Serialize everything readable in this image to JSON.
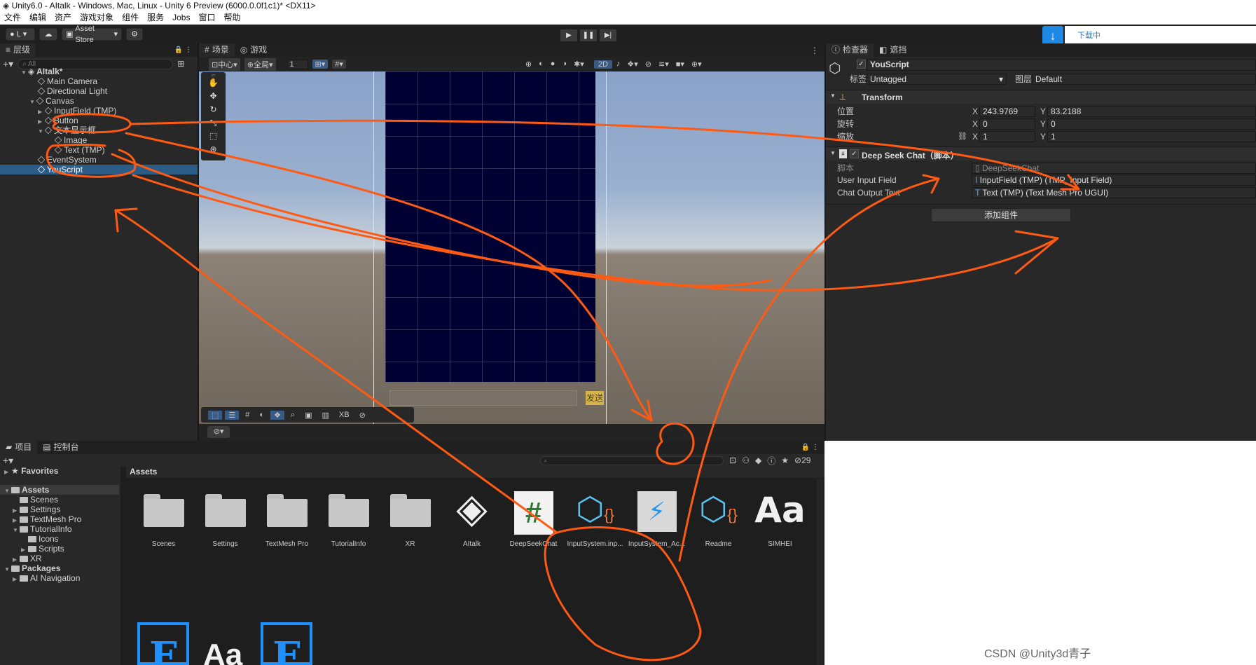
{
  "window": {
    "title": "Unity6.0 - AItalk - Windows, Mac, Linux - Unity 6 Preview (6000.0.0f1c1)* <DX11>"
  },
  "menu": [
    "文件",
    "编辑",
    "资产",
    "游戏对象",
    "组件",
    "服务",
    "Jobs",
    "窗口",
    "帮助"
  ],
  "toolbar": {
    "account": "L",
    "asset_store": "Asset Store",
    "download_label": "下载中"
  },
  "hierarchy": {
    "tab": "层级",
    "search_placeholder": "All",
    "items": [
      {
        "label": "AItalk*"
      },
      {
        "label": "Main Camera"
      },
      {
        "label": "Directional Light"
      },
      {
        "label": "Canvas"
      },
      {
        "label": "InputField (TMP)"
      },
      {
        "label": "Button"
      },
      {
        "label": "文本显示框"
      },
      {
        "label": "Image"
      },
      {
        "label": "Text (TMP)"
      },
      {
        "label": "EventSystem"
      },
      {
        "label": "YouScript"
      }
    ]
  },
  "scene": {
    "tab_scene": "场景",
    "tab_game": "游戏",
    "pivot": "中心",
    "global": "全局",
    "grid_value": "1",
    "mode_2d": "2D",
    "send_button": "发送",
    "overlay_xb": "XB"
  },
  "inspector": {
    "tab": "检查器",
    "tab2": "遮挡",
    "object_name": "YouScript",
    "tag_label": "标签",
    "tag_value": "Untagged",
    "layer_label": "图层",
    "layer_value": "Default",
    "transform": {
      "title": "Transform",
      "position_label": "位置",
      "rotation_label": "旋转",
      "scale_label": "缩放",
      "pos_x": "243.9769",
      "pos_y": "83.2188",
      "rot_x": "0",
      "rot_y": "0",
      "scl_x": "1",
      "scl_y": "1",
      "x": "X",
      "y": "Y"
    },
    "component": {
      "title": "Deep Seek Chat（脚本）",
      "script_label": "脚本",
      "script_value": "DeepSeekChat",
      "input_label": "User Input Field",
      "input_value": "InputField (TMP) (TMP_Input Field)",
      "output_label": "Chat Output Text",
      "output_value": "Text (TMP) (Text Mesh Pro UGUI)"
    },
    "add_component": "添加组件"
  },
  "project": {
    "tab": "项目",
    "tab2": "控制台",
    "hidden_count": "29",
    "favorites": "Favorites",
    "assets_header": "Assets",
    "tree": [
      "Assets",
      "Scenes",
      "Settings",
      "TextMesh Pro",
      "TutorialInfo",
      "Icons",
      "Scripts",
      "XR",
      "Packages",
      "AI Navigation"
    ],
    "grid": [
      {
        "label": "Scenes",
        "icon": "folder-icon"
      },
      {
        "label": "Settings",
        "icon": "folder-icon"
      },
      {
        "label": "TextMesh Pro",
        "icon": "folder-icon"
      },
      {
        "label": "TutorialInfo",
        "icon": "folder-icon"
      },
      {
        "label": "XR",
        "icon": "folder-icon"
      },
      {
        "label": "AItalk",
        "icon": "unity-scene-icon"
      },
      {
        "label": "DeepSeekChat",
        "icon": "csharp-script-icon"
      },
      {
        "label": "InputSystem.inp...",
        "icon": "input-actions-icon"
      },
      {
        "label": "InputSystem_Ac...",
        "icon": "input-map-icon"
      },
      {
        "label": "Readme",
        "icon": "readme-icon"
      },
      {
        "label": "SIMHEI",
        "icon": "font-icon"
      }
    ]
  },
  "watermark": "CSDN @Unity3d青子",
  "colors": {
    "annotation": "#ff5a14",
    "selection": "#2c5d87",
    "canvas": "#000033",
    "send_button": "#d4b44a"
  }
}
